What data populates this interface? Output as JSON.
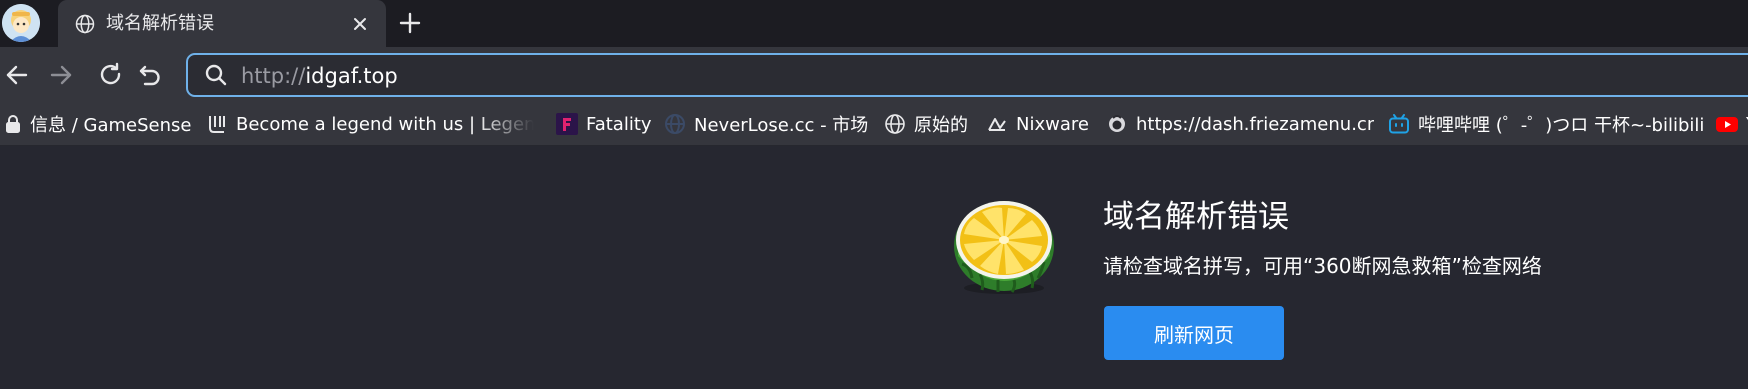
{
  "tab": {
    "title": "域名解析错误",
    "favicon": "globe-icon"
  },
  "toolbar": {
    "url_scheme": "http://",
    "url_host": "idgaf.top",
    "accent_color": "#6fb1e9"
  },
  "bookmarks": [
    {
      "label": "信息 / GameSense",
      "icon": "lock-icon"
    },
    {
      "label": "Become a legend with us | Legend",
      "icon": "legend-logo-icon"
    },
    {
      "label": "Fatality",
      "icon": "fatality-logo-icon"
    },
    {
      "label": "NeverLose.cc - 市场",
      "icon": "neverlose-logo-icon"
    },
    {
      "label": "原始的",
      "icon": "globe-icon"
    },
    {
      "label": "Nixware",
      "icon": "nixware-logo-icon"
    },
    {
      "label": "https://dash.friezamenu.cn/",
      "icon": "frieza-logo-icon"
    },
    {
      "label": "哔哩哔哩 (゜-゜)つロ 干杯~-bilibili",
      "icon": "bilibili-logo-icon"
    },
    {
      "label": "Y",
      "icon": "youtube-logo-icon"
    }
  ],
  "page": {
    "title": "域名解析错误",
    "description": "请检查域名拼写，可用“360断网急救箱”检查网络",
    "refresh_label": "刷新网页",
    "button_color": "#2a8cf0"
  }
}
